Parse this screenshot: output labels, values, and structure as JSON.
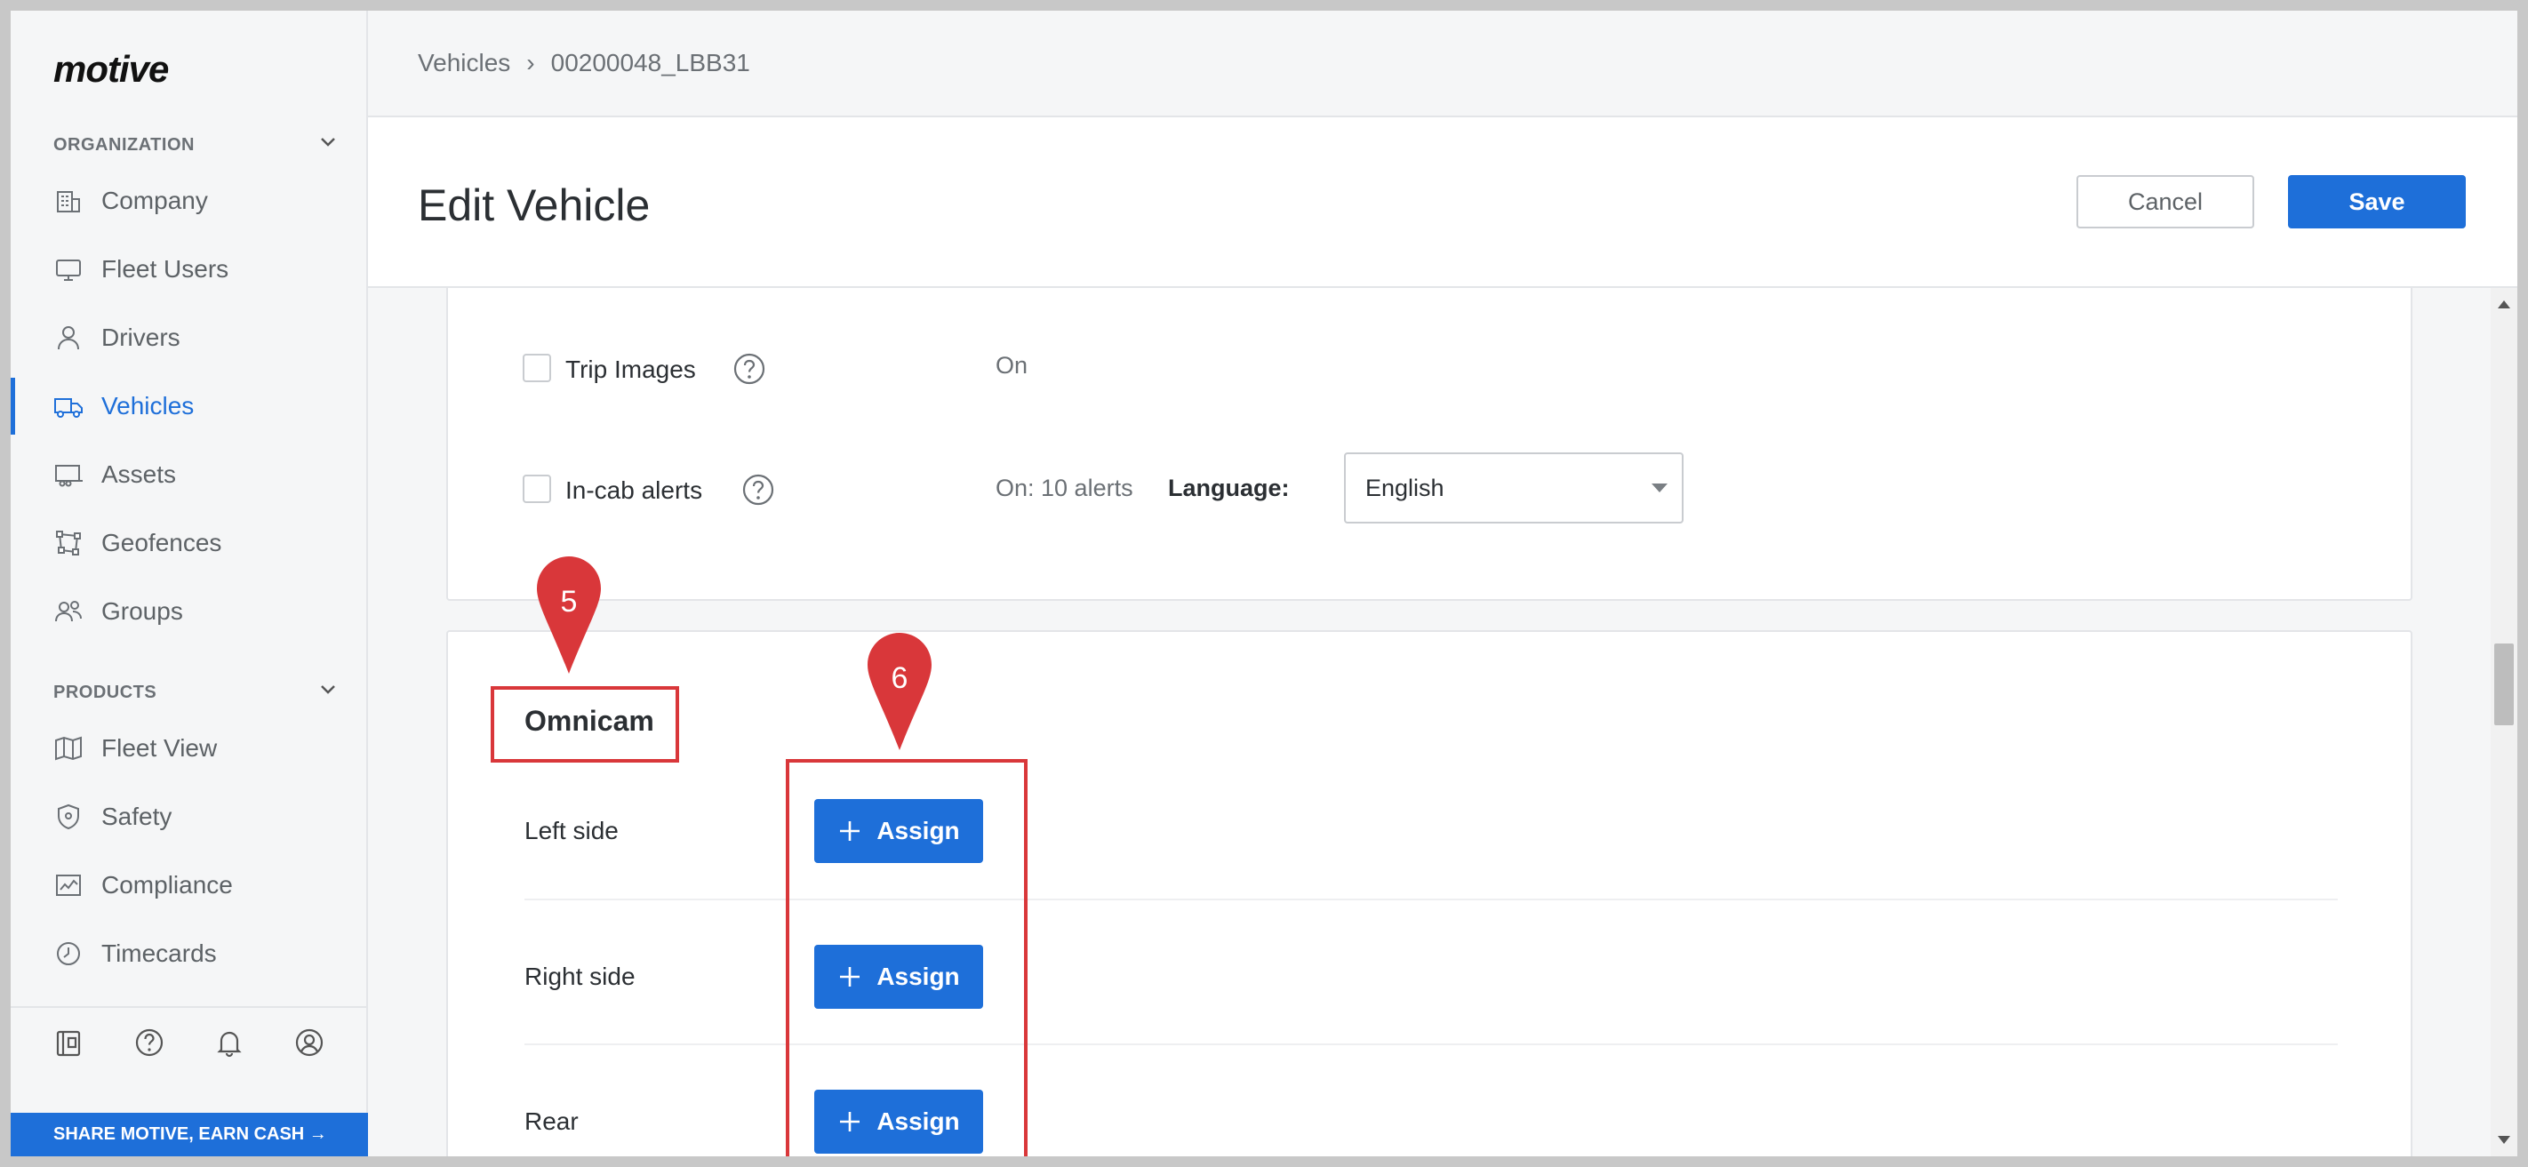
{
  "brand": {
    "logo_text": "motive"
  },
  "sidebar": {
    "organization_heading": "ORGANIZATION",
    "products_heading": "PRODUCTS",
    "org_items": [
      {
        "label": "Company",
        "icon": "building-icon"
      },
      {
        "label": "Fleet Users",
        "icon": "monitor-icon"
      },
      {
        "label": "Drivers",
        "icon": "person-icon"
      },
      {
        "label": "Vehicles",
        "icon": "truck-icon",
        "active": true
      },
      {
        "label": "Assets",
        "icon": "trailer-icon"
      },
      {
        "label": "Geofences",
        "icon": "geofence-icon"
      },
      {
        "label": "Groups",
        "icon": "group-icon"
      }
    ],
    "product_items": [
      {
        "label": "Fleet View",
        "icon": "map-icon"
      },
      {
        "label": "Safety",
        "icon": "shield-icon"
      },
      {
        "label": "Compliance",
        "icon": "chart-icon"
      },
      {
        "label": "Timecards",
        "icon": "clock-icon"
      }
    ],
    "bottom_icons": [
      "wallet-icon",
      "help-icon",
      "bell-icon",
      "user-circle-icon"
    ],
    "share_banner": "SHARE MOTIVE, EARN CASH →"
  },
  "breadcrumb": {
    "parent": "Vehicles",
    "separator": "›",
    "current": "00200048_LBB31"
  },
  "page": {
    "title": "Edit Vehicle",
    "cancel_label": "Cancel",
    "save_label": "Save"
  },
  "settings": {
    "trip_images": {
      "label": "Trip Images",
      "value": "On"
    },
    "incab_alerts": {
      "label": "In-cab alerts",
      "value": "On: 10 alerts",
      "language_label": "Language:",
      "language_value": "English"
    }
  },
  "omnicam": {
    "title": "Omnicam",
    "rows": [
      {
        "label": "Left side",
        "button": "Assign"
      },
      {
        "label": "Right side",
        "button": "Assign"
      },
      {
        "label": "Rear",
        "button": "Assign"
      }
    ]
  },
  "annotations": {
    "pin_5": "5",
    "pin_6": "6"
  },
  "colors": {
    "accent": "#1e6fd9",
    "annotation": "#d9373a",
    "sidebar_bg": "#f5f6f7"
  }
}
